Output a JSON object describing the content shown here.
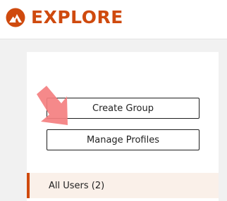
{
  "header": {
    "brand": "EXPLORE",
    "logo_icon": "flame-icon",
    "brand_color": "#cf4a0e"
  },
  "actions": {
    "create_group_label": "Create Group",
    "manage_profiles_label": "Manage Profiles"
  },
  "user_list": {
    "items": [
      {
        "label": "All Users (2)",
        "selected": true
      }
    ]
  },
  "annotation": {
    "icon": "pointer-arrow-icon",
    "color": "#f47f80"
  }
}
